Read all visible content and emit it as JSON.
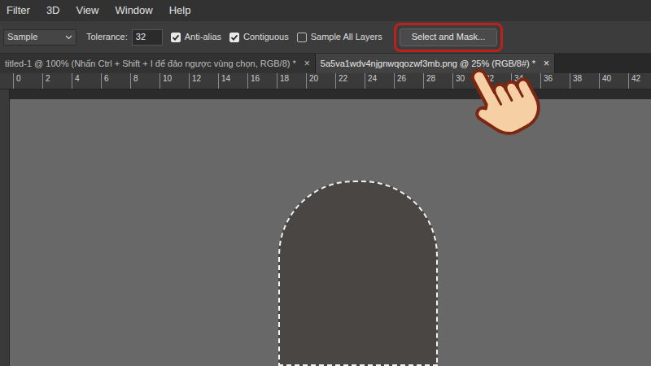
{
  "menu": [
    "Filter",
    "3D",
    "View",
    "Window",
    "Help"
  ],
  "options": {
    "sample": {
      "value": "Sample"
    },
    "tolerance": {
      "label": "Tolerance:",
      "value": "32"
    },
    "checkboxes": [
      {
        "label": "Anti-alias",
        "checked": true
      },
      {
        "label": "Contiguous",
        "checked": true
      },
      {
        "label": "Sample All Layers",
        "checked": false
      }
    ],
    "button": {
      "label": "Select and Mask...",
      "highlighted": true
    }
  },
  "tabs": [
    {
      "label": "titled-1 @ 100% (Nhấn Ctrl + Shift + I để đảo ngược vùng chọn, RGB/8) *",
      "selected": false,
      "close": "×"
    },
    {
      "label": "5a5va1wdv4njgnwqqozwf3mb.png @ 25% (RGB/8#) *",
      "selected": true,
      "close": "×"
    }
  ],
  "ruler": [
    "0",
    "2",
    "4",
    "6",
    "8",
    "10",
    "12",
    "14",
    "16",
    "18",
    "20",
    "22",
    "24",
    "26",
    "28",
    "30",
    "32",
    "34",
    "36",
    "38",
    "40",
    "42"
  ]
}
